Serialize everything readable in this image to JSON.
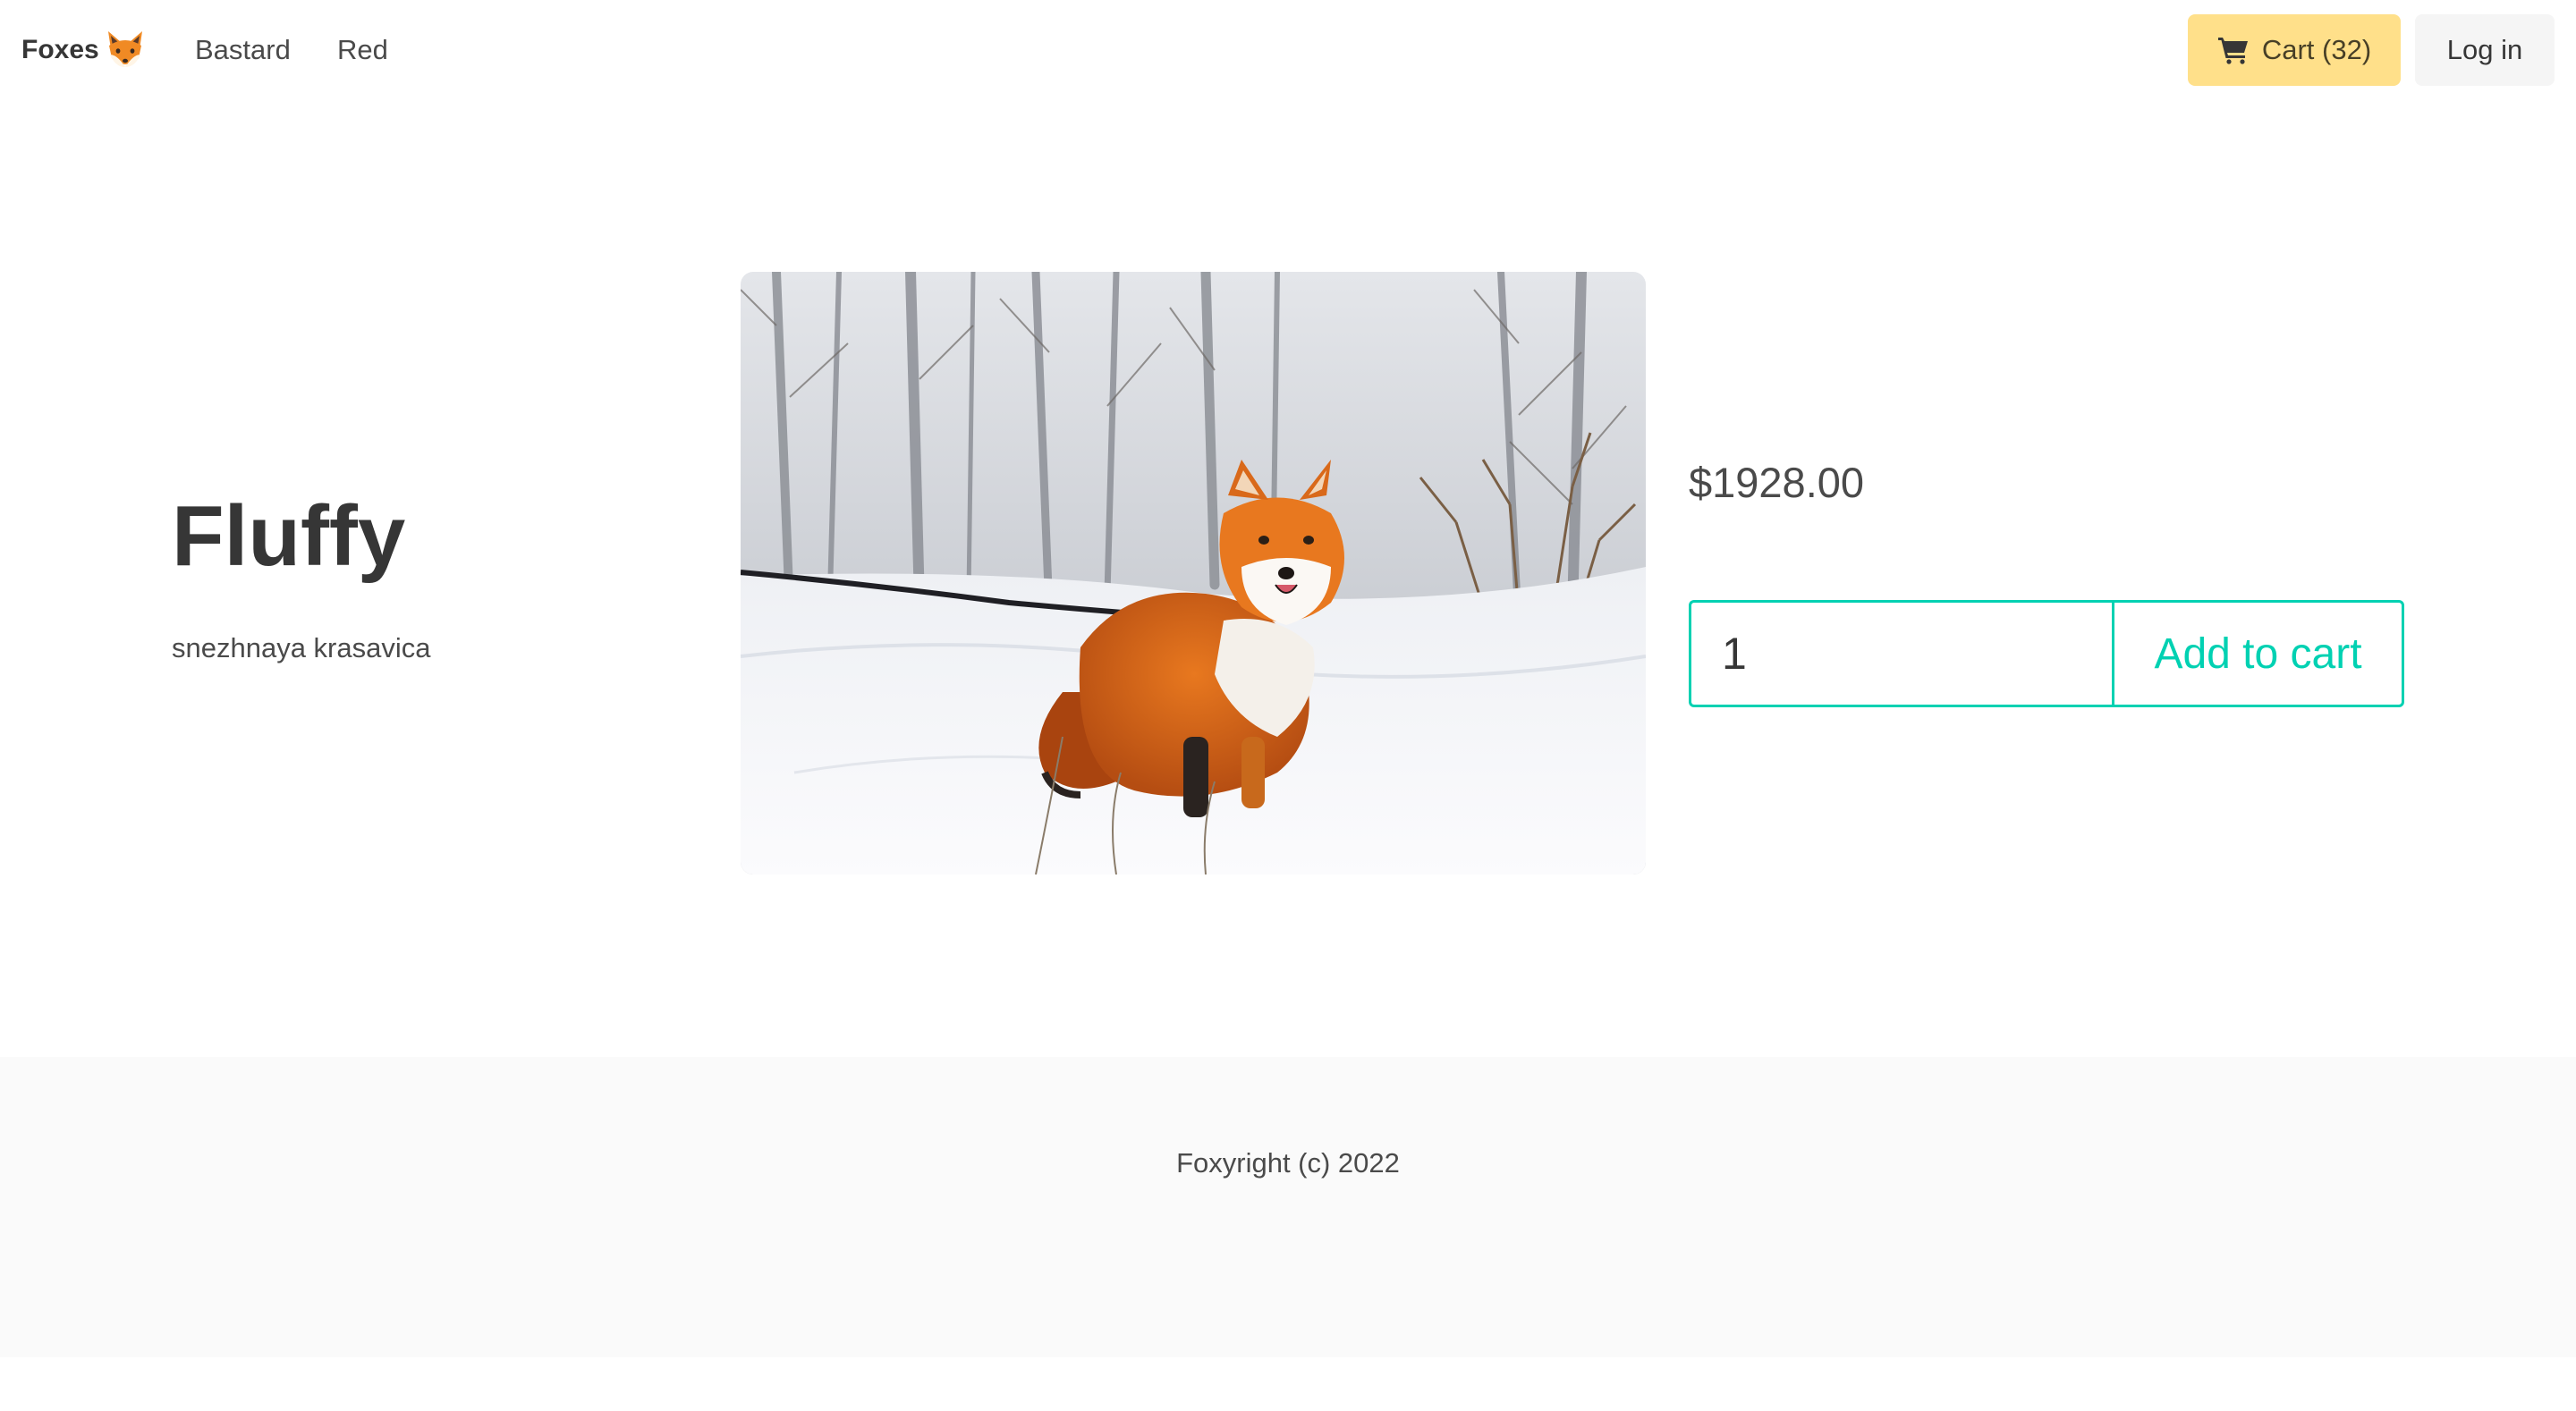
{
  "navbar": {
    "brand_label": "Foxes",
    "brand_icon": "fox-face-emoji",
    "links": [
      {
        "label": "Bastard"
      },
      {
        "label": "Red"
      }
    ],
    "cart": {
      "label": "Cart (32)",
      "icon": "shopping-cart-icon",
      "color": "#ffe08a"
    },
    "login_label": "Log in"
  },
  "product": {
    "title": "Fluffy",
    "subtitle": "snezhnaya krasavica",
    "image": "red fox sitting in snow on a leash, bare winter trees behind",
    "price": "$1928.00",
    "quantity_value": "1",
    "add_to_cart_label": "Add to cart",
    "accent_color": "#00d1b2"
  },
  "footer": {
    "text": "Foxyright (c) 2022"
  }
}
